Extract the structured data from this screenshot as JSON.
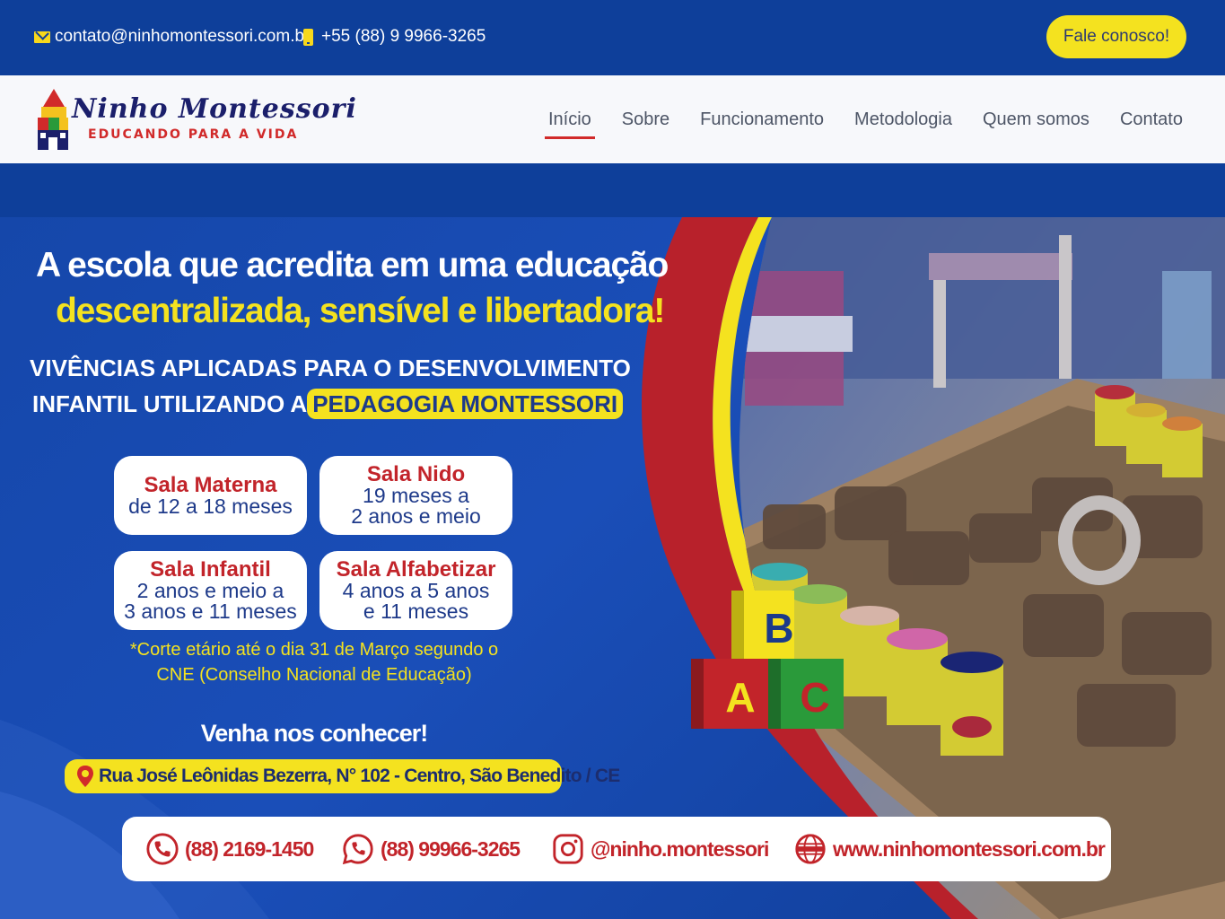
{
  "topbar": {
    "email": "contato@ninhomontessori.com.br",
    "phone": "+55 (88) 9 9966-3265",
    "cta_label": "Fale conosco!"
  },
  "logo": {
    "name": "Ninho Montessori",
    "tagline": "EDUCANDO PARA A VIDA"
  },
  "nav": {
    "items": [
      "Início",
      "Sobre",
      "Funcionamento",
      "Metodologia",
      "Quem somos",
      "Contato"
    ],
    "active": "Início"
  },
  "hero": {
    "headline_line1": "A escola que acredita em uma educação",
    "headline_line2": "descentralizada, sensível e libertadora!",
    "sub_line1": "VIVÊNCIAS APLICADAS PARA O DESENVOLVIMENTO",
    "sub_line2_prefix": "INFANTIL UTILIZANDO A",
    "sub_line2_highlight": "PEDAGOGIA MONTESSORI",
    "classes": [
      {
        "title": "Sala Materna",
        "line1": "de 12 a 18 meses",
        "line2": ""
      },
      {
        "title": "Sala Nido",
        "line1": "19 meses a",
        "line2": "2 anos e meio"
      },
      {
        "title": "Sala Infantil",
        "line1": "2 anos e meio a",
        "line2": "3 anos e 11 meses"
      },
      {
        "title": "Sala Alfabetizar",
        "line1": "4 anos a 5 anos",
        "line2": "e 11 meses"
      }
    ],
    "note_line1": "*Corte etário até o dia 31 de Março segundo o",
    "note_line2": "CNE (Conselho Nacional de Educação)",
    "visit": "Venha nos conhecer!",
    "address": "Rua José Leônidas Bezerra, N° 102  -  Centro, São Benedito / CE",
    "blocks": [
      "B",
      "A",
      "C"
    ]
  },
  "contacts": {
    "phone": "(88) 2169-1450",
    "whatsapp": "(88) 99966-3265",
    "instagram": "@ninho.montessori",
    "website": "www.ninhomontessori.com.br"
  },
  "colors": {
    "brand_blue": "#0e3f9a",
    "accent_yellow": "#f4e21f",
    "accent_red": "#c2242a"
  },
  "icons": [
    "mail-icon",
    "phone-icon",
    "location-pin-icon",
    "phone-handset-icon",
    "whatsapp-icon",
    "instagram-icon",
    "globe-icon"
  ]
}
